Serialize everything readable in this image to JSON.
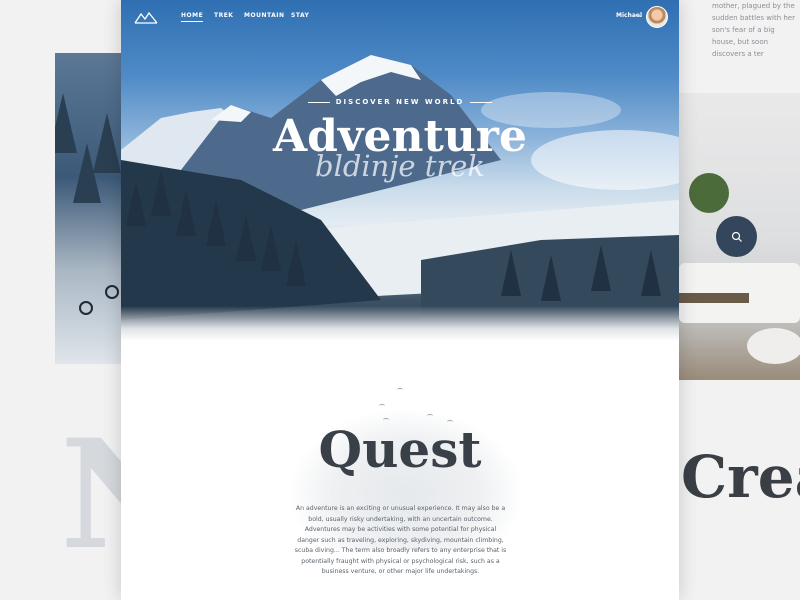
{
  "nav": {
    "items": [
      "HOME",
      "TREK",
      "MOUNTAIN",
      "STAY"
    ],
    "user_name": "Michael",
    "user_caret": "⌄"
  },
  "hero": {
    "tagline": "DISCOVER NEW WORLD",
    "title": "Adventure",
    "script": "bldinje trek"
  },
  "content": {
    "title": "Quest",
    "body": "An adventure is an exciting or unusual experience. It may also be a bold, usually risky undertaking, with an uncertain outcome. Adventures may be activities with some potential for physical danger such as traveling, exploring, skydiving, mountain climbing, scuba diving... The term also broadly refers to any enterprise that is potentially fraught with physical or psychological risk, such as a business venture, or other major life undertakings."
  },
  "side": {
    "right_text": "mother, plagued by the sudden battles with her son's fear of a big house, but soon discovers a ter",
    "right_letter": "Crea",
    "left_letter": "N"
  },
  "colors": {
    "search_button": "#33465b",
    "heading": "#3a4048"
  }
}
